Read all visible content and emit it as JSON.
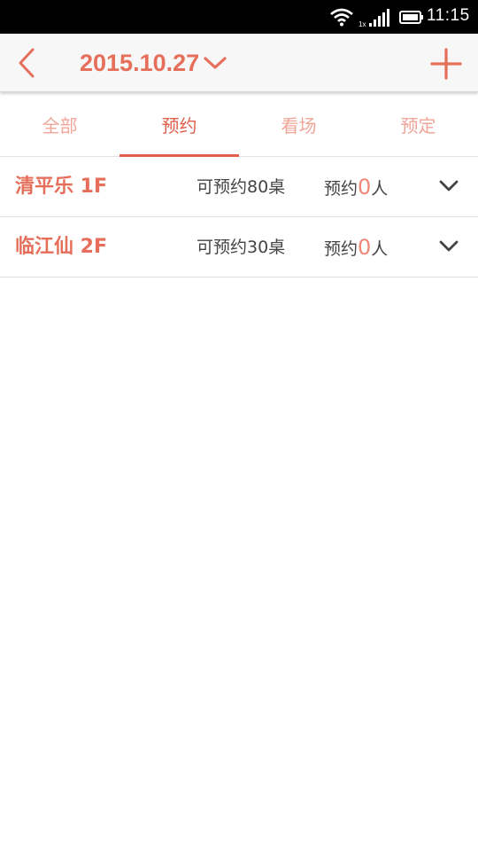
{
  "status_bar": {
    "time": "11:15",
    "signal_label": "1x"
  },
  "header": {
    "date": "2015.10.27"
  },
  "tabs": [
    {
      "label": "全部",
      "active": false
    },
    {
      "label": "预约",
      "active": true
    },
    {
      "label": "看场",
      "active": false
    },
    {
      "label": "预定",
      "active": false
    }
  ],
  "venues": [
    {
      "name": "清平乐 1F",
      "available": "可预约80桌",
      "reserved_prefix": "预约",
      "reserved_count": "0",
      "reserved_suffix": "人"
    },
    {
      "name": "临江仙 2F",
      "available": "可预约30桌",
      "reserved_prefix": "预约",
      "reserved_count": "0",
      "reserved_suffix": "人"
    }
  ],
  "colors": {
    "accent": "#e56f5a",
    "tab_inactive": "#f0a598",
    "count_highlight": "#f08877"
  }
}
